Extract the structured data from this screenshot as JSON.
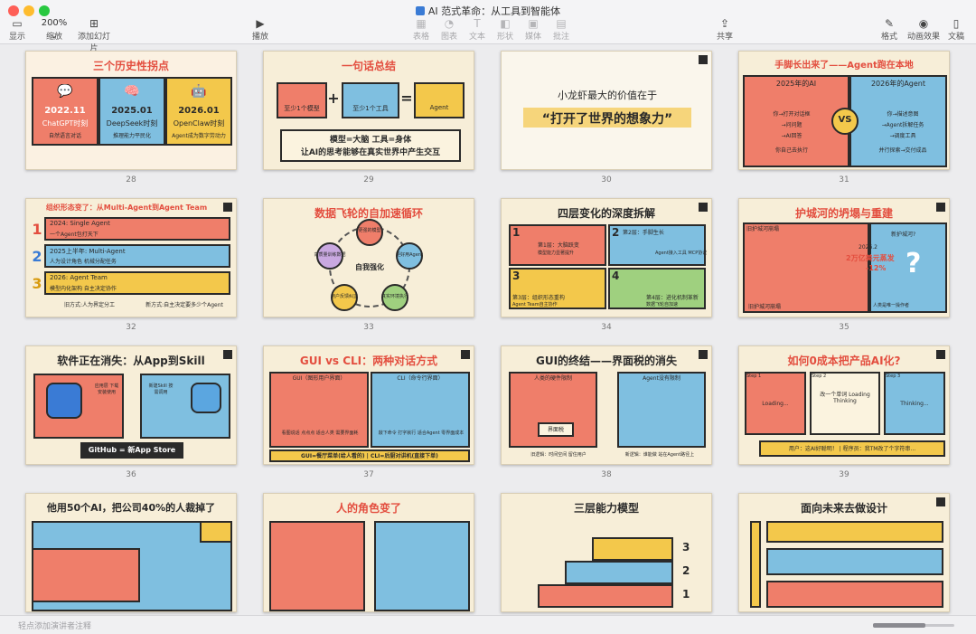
{
  "window": {
    "title": "AI 范式革命：从工具到智能体"
  },
  "toolbar": {
    "left": [
      {
        "label": "显示",
        "icon": "sidebar-icon"
      },
      {
        "label": "缩放",
        "value": "200%",
        "icon": "chevron-down-icon"
      },
      {
        "label": "添加幻灯片",
        "icon": "add-slide-icon"
      }
    ],
    "play": {
      "label": "播放",
      "icon": "play-icon"
    },
    "center": [
      {
        "label": "表格",
        "icon": "table-icon"
      },
      {
        "label": "图表",
        "icon": "chart-icon"
      },
      {
        "label": "文本",
        "icon": "text-icon"
      },
      {
        "label": "形状",
        "icon": "shape-icon"
      },
      {
        "label": "媒体",
        "icon": "media-icon"
      },
      {
        "label": "批注",
        "icon": "comment-icon"
      }
    ],
    "share": {
      "label": "共享",
      "icon": "share-icon"
    },
    "right": [
      {
        "label": "格式",
        "icon": "format-icon"
      },
      {
        "label": "动画效果",
        "icon": "animate-icon"
      },
      {
        "label": "文稿",
        "icon": "document-icon"
      }
    ]
  },
  "slides": [
    {
      "num": "28",
      "title": "三个历史性拐点",
      "cols": [
        {
          "date": "2022.11",
          "name": "ChatGPT时刻",
          "sub": "自然语言对话"
        },
        {
          "date": "2025.01",
          "name": "DeepSeek时刻",
          "sub": "推理能力平民化"
        },
        {
          "date": "2026.01",
          "name": "OpenClaw时刻",
          "sub": "Agent成为数字劳动力"
        }
      ]
    },
    {
      "num": "29",
      "title": "一句话总结",
      "boxes": [
        "至少1个模型",
        "至少1个工具",
        "Agent"
      ],
      "line1": "模型=大脑  工具=身体",
      "line2": "让AI的思考能够在真实世界中产生交互"
    },
    {
      "num": "30",
      "line1": "小龙虾最大的价值在于",
      "line2": "“打开了世界的想象力”"
    },
    {
      "num": "31",
      "title": "手脚长出来了——Agent跑在本地",
      "left_head": "2025年的AI",
      "right_head": "2026年的Agent",
      "vs": "VS",
      "left_lines": [
        "你→打开对话框",
        "→问问题",
        "→AI回答",
        "你自己去执行"
      ],
      "right_lines": [
        "你→描述意图",
        "→Agent拆解任务",
        "→调度工具",
        "并行探索→交付成品"
      ]
    },
    {
      "num": "32",
      "title": "组织形态变了：从Multi-Agent到Agent Team",
      "rows": [
        {
          "n": "1",
          "head": "2024: Single Agent",
          "sub": "一个Agent包打天下"
        },
        {
          "n": "2",
          "head": "2025上半年: Multi-Agent",
          "sub": "人为设计角色 机械分配任务"
        },
        {
          "n": "3",
          "head": "2026: Agent Team",
          "sub": "模型内化架构 自主决定协作"
        }
      ],
      "foot_left": "旧方式:人为界定分工",
      "foot_right": "新方式:自主决定要多少个Agent"
    },
    {
      "num": "33",
      "title": "数据飞轮的自加速循环",
      "center": "自我强化",
      "nodes": [
        "更强的模型",
        "更好用Agent",
        "真实环境执行",
        "用户反馈纠正",
        "高质量训练数据"
      ]
    },
    {
      "num": "34",
      "title": "四层变化的深度拆解",
      "cells": [
        {
          "n": "1",
          "head": "第1层：大脑跃变",
          "sub": "模型能力显著提升"
        },
        {
          "n": "2",
          "head": "第2层：手脚生长",
          "sub": "Agent接入工具 MCP协议"
        },
        {
          "n": "3",
          "head": "第3层：组织形态重构",
          "sub": "Agent Team自主协作"
        },
        {
          "n": "4",
          "head": "第4层：进化机制革新",
          "sub": "数据飞轮自加速"
        }
      ]
    },
    {
      "num": "35",
      "title": "护城河的坍塌与重建",
      "old": "旧护城河崩塌",
      "new": "新护城河?",
      "stat1": "2026.2",
      "stat2": "2万亿美元蒸发",
      "stat3": "-12%",
      "foot_left": "旧护城河崩塌",
      "foot_right": "人类是唯一操作者",
      "qmark": "?"
    },
    {
      "num": "36",
      "title": "软件正在消失：从App到Skill",
      "down": "应用层 下载安装使用",
      "up": "新建Skill 按需调用",
      "banner": "GitHub = 新App Store"
    },
    {
      "num": "37",
      "title": "GUI vs CLI：两种对话方式",
      "left_head": "GUI（图形用户界面）",
      "right_head": "CLI（命令行界面）",
      "left_sub": "看图说话 点点点 适合人类 需要界面耗",
      "right_sub": "敲下命令 打字就行 适合Agent 零界面成本",
      "foot": "GUI=餐厅菜单(给人看的) | CLI=后厨对讲机(直接下单)"
    },
    {
      "num": "38",
      "title": "GUI的终结——界面税的消失",
      "left_head": "人类的硬件限制",
      "right_head": "Agent没有限制",
      "left_box": "界面税",
      "foot_left": "旧逻辑：时间空间 留住用户",
      "foot_right": "新逻辑：谁能做 站在Agent路径上"
    },
    {
      "num": "39",
      "title": "如何0成本把产品AI化?",
      "step1": "Step 1",
      "step2": "Step 2",
      "step3": "Step 3",
      "loading": "Loading...",
      "thinking": "Thinking...",
      "mid": "改一个单词 Loading Thinking",
      "foot": "用户：这AI好聪明！ | 程序员：我TM改了个字符串..."
    },
    {
      "num": "",
      "title": "他用50个AI，把公司40%的人裁掉了"
    },
    {
      "num": "",
      "title": "人的角色变了"
    },
    {
      "num": "",
      "title": "三层能力模型",
      "levels": [
        "3",
        "2",
        "1"
      ]
    },
    {
      "num": "",
      "title": "面向未来去做设计"
    }
  ],
  "bottombar": {
    "notes_placeholder": "轻点添加演讲者注释"
  },
  "colors": {
    "red": "#ef7e6a",
    "blue": "#7fbfe0",
    "yellow": "#f3c84b",
    "cream": "#f7eed8",
    "ink": "#2a2a2a"
  }
}
